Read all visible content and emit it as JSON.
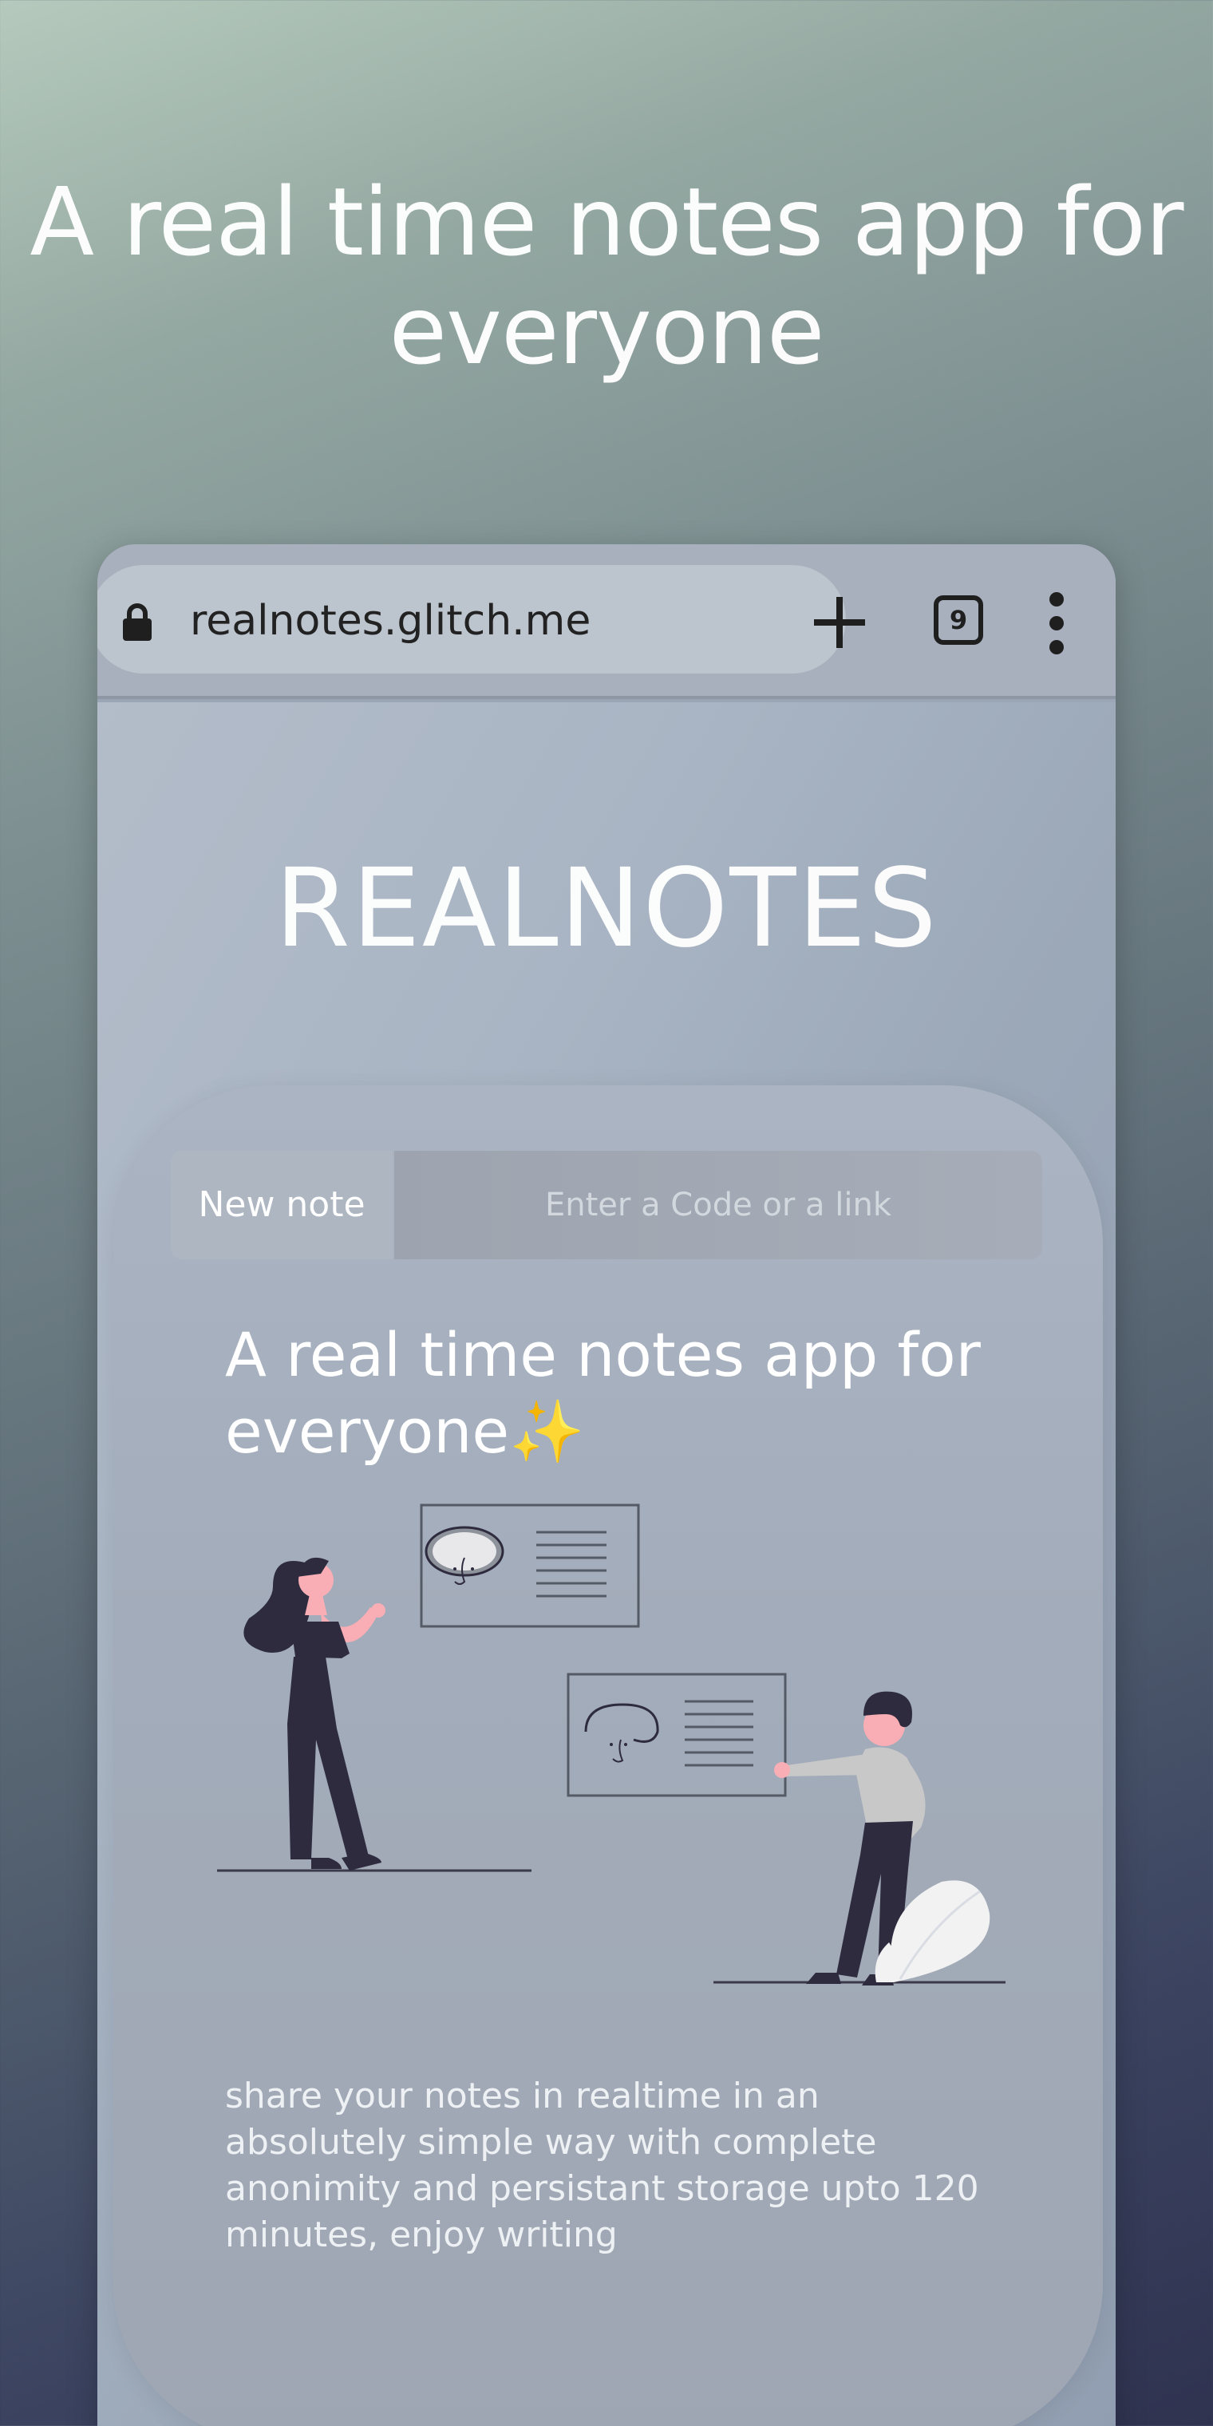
{
  "hero": {
    "title": "A real time notes app for everyone"
  },
  "browser": {
    "url": "realnotes.glitch.me",
    "tab_count": "9",
    "icons": [
      "lock-icon",
      "plus-icon",
      "tabs-icon",
      "more-vert-icon"
    ]
  },
  "app": {
    "title": "REALNOTES",
    "new_note_label": "New note",
    "code_input_placeholder": "Enter a Code or a link",
    "tagline": "A real time notes app for everyone✨",
    "description": "share your notes in realtime in an absolutely simple way with complete anonimity and persistant storage upto 120 minutes, enjoy writing"
  },
  "colors": {
    "accent_skin": "#f8aeb4",
    "figure_dark": "#2e2b3f",
    "shirt_gray": "#c8c8c8"
  }
}
